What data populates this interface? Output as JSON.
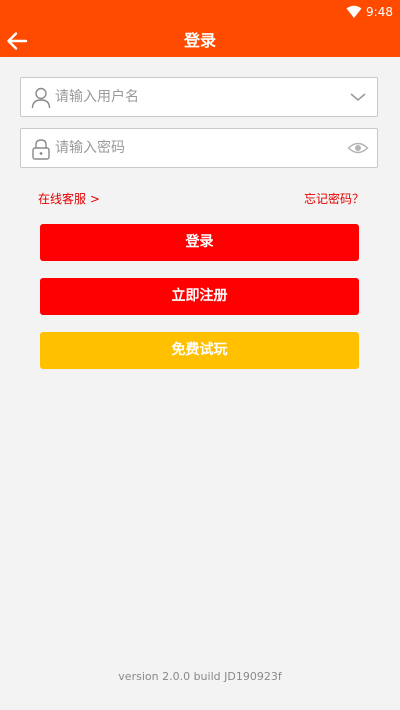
{
  "status_bar": {
    "time": "9:48",
    "wifi_icon": "wifi-icon"
  },
  "app_bar": {
    "title": "登录",
    "back_icon": "arrow-left-icon"
  },
  "form": {
    "username": {
      "placeholder": "请输入用户名",
      "value": "",
      "lead_icon": "user-icon",
      "trail_icon": "chevron-down-icon"
    },
    "password": {
      "placeholder": "请输入密码",
      "value": "",
      "lead_icon": "lock-icon",
      "trail_icon": "eye-icon"
    }
  },
  "links": {
    "online_service": "在线客服 >",
    "forgot_password": "忘记密码？"
  },
  "buttons": {
    "login": "登录",
    "register": "立即注册",
    "free_trial": "免费试玩"
  },
  "footer": {
    "version": "version 2.0.0  build JD190923f"
  },
  "colors": {
    "header": "#ff4b00",
    "primary_button": "#ff0000",
    "trial_button": "#ffc000",
    "link": "#e30000",
    "background": "#f3f3f3"
  }
}
